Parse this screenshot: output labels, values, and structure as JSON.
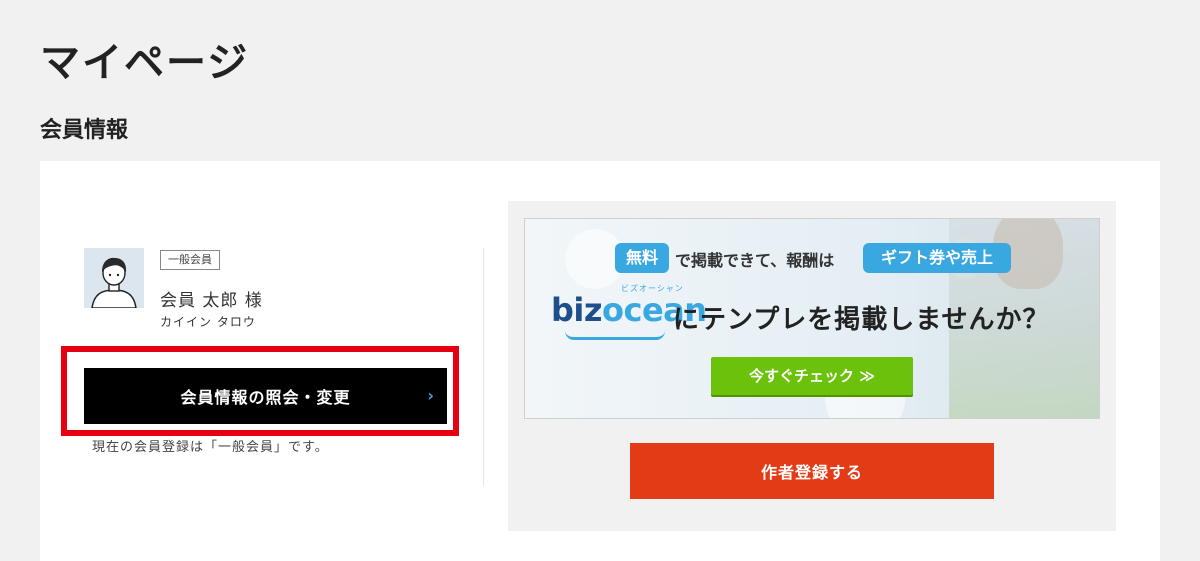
{
  "page": {
    "title": "マイページ"
  },
  "section": {
    "title": "会員情報"
  },
  "member": {
    "badge": "一般会員",
    "name": "会員 太郎 様",
    "kana": "カイイン タロウ",
    "status": "現在の会員登録は「一般会員」です。"
  },
  "buttons": {
    "profile": "会員情報の照会・変更",
    "profile_chevron": "›",
    "author_register": "作者登録する"
  },
  "banner": {
    "pill_free": "無料",
    "line1": "で掲載できて、報酬は",
    "pill_gift": "ギフト券や売上",
    "logo_text_biz": "biz",
    "logo_text_ocean": "ocean",
    "logo_sub": "ビズオーシャン",
    "headline": "にテンプレを掲載しませんか？",
    "cta": "今すぐチェック ≫"
  },
  "colors": {
    "background": "#f1f1f1",
    "card": "#ffffff",
    "profile_button": "#000000",
    "author_button": "#e23b16",
    "highlight": "#e60012",
    "pill": "#39a8e0",
    "cta": "#6cc10a"
  },
  "icons": {
    "avatar": "user-avatar-icon",
    "chevron": "chevron-right-icon"
  }
}
